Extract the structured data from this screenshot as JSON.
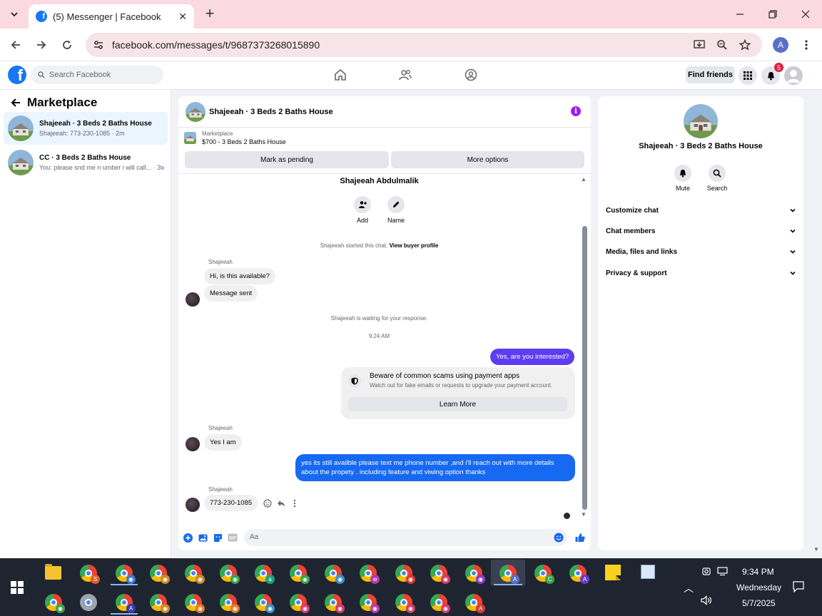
{
  "browser": {
    "tab_title": "(5) Messenger | Facebook",
    "url": "facebook.com/messages/t/9687373268015890",
    "profile_initial": "A"
  },
  "fb": {
    "search_placeholder": "Search Facebook",
    "find_friends": "Find friends",
    "notification_count": "5"
  },
  "sidebar": {
    "title": "Marketplace",
    "conversations": [
      {
        "name": "Shajeeah · 3 Beds 2 Baths House",
        "preview": "Shajeeah: 773-230-1085 · 2m",
        "active": true
      },
      {
        "name": "CC · 3 Beds 2 Baths House",
        "preview": "You: please snd me n umber i will call... · 3w",
        "active": false
      }
    ]
  },
  "chat": {
    "title": "Shajeeah · 3 Beds 2 Baths House",
    "listing_source": "Marketplace",
    "listing_price": "$700 - 3 Beds 2 Baths House",
    "btn_pending": "Mark as pending",
    "btn_more": "More options",
    "buyer_name": "Shajeeah Abdulmalik",
    "action_add": "Add",
    "action_name": "Name",
    "started_text": "Shajeeah started this chat.",
    "view_profile": "View buyer profile",
    "sender": "Shajeeah",
    "msg1": "Hi, is this available?",
    "msg2": "Message sent",
    "waiting": "Shajeeah is waiting for your response.",
    "time": "9:24 AM",
    "out1": "Yes, are you interested?",
    "scam_title": "Beware of common scams using payment apps",
    "scam_desc": "Watch out for fake emails or requests to upgrade your payment account.",
    "learn_more": "Learn More",
    "msg3": "Yes I am",
    "out2": "yes its still availble please text me phone number ,and i'll reach out with more details about the propety . including feature and viwing option thanks",
    "msg4": "773-230-1085",
    "composer_placeholder": "Aa"
  },
  "details": {
    "title": "Shajeeah · 3 Beds 2 Baths House",
    "mute": "Mute",
    "search": "Search",
    "sections": [
      "Customize chat",
      "Chat members",
      "Media, files and links",
      "Privacy & support"
    ]
  },
  "taskbar": {
    "time": "9:34 PM",
    "day": "Wednesday",
    "date": "5/7/2025"
  },
  "colors": {
    "fb_blue": "#1877f2",
    "outgoing_purple": "#5d3df1",
    "outgoing_blue": "#1669f0",
    "tabstrip_pink": "#fbd9e0"
  }
}
